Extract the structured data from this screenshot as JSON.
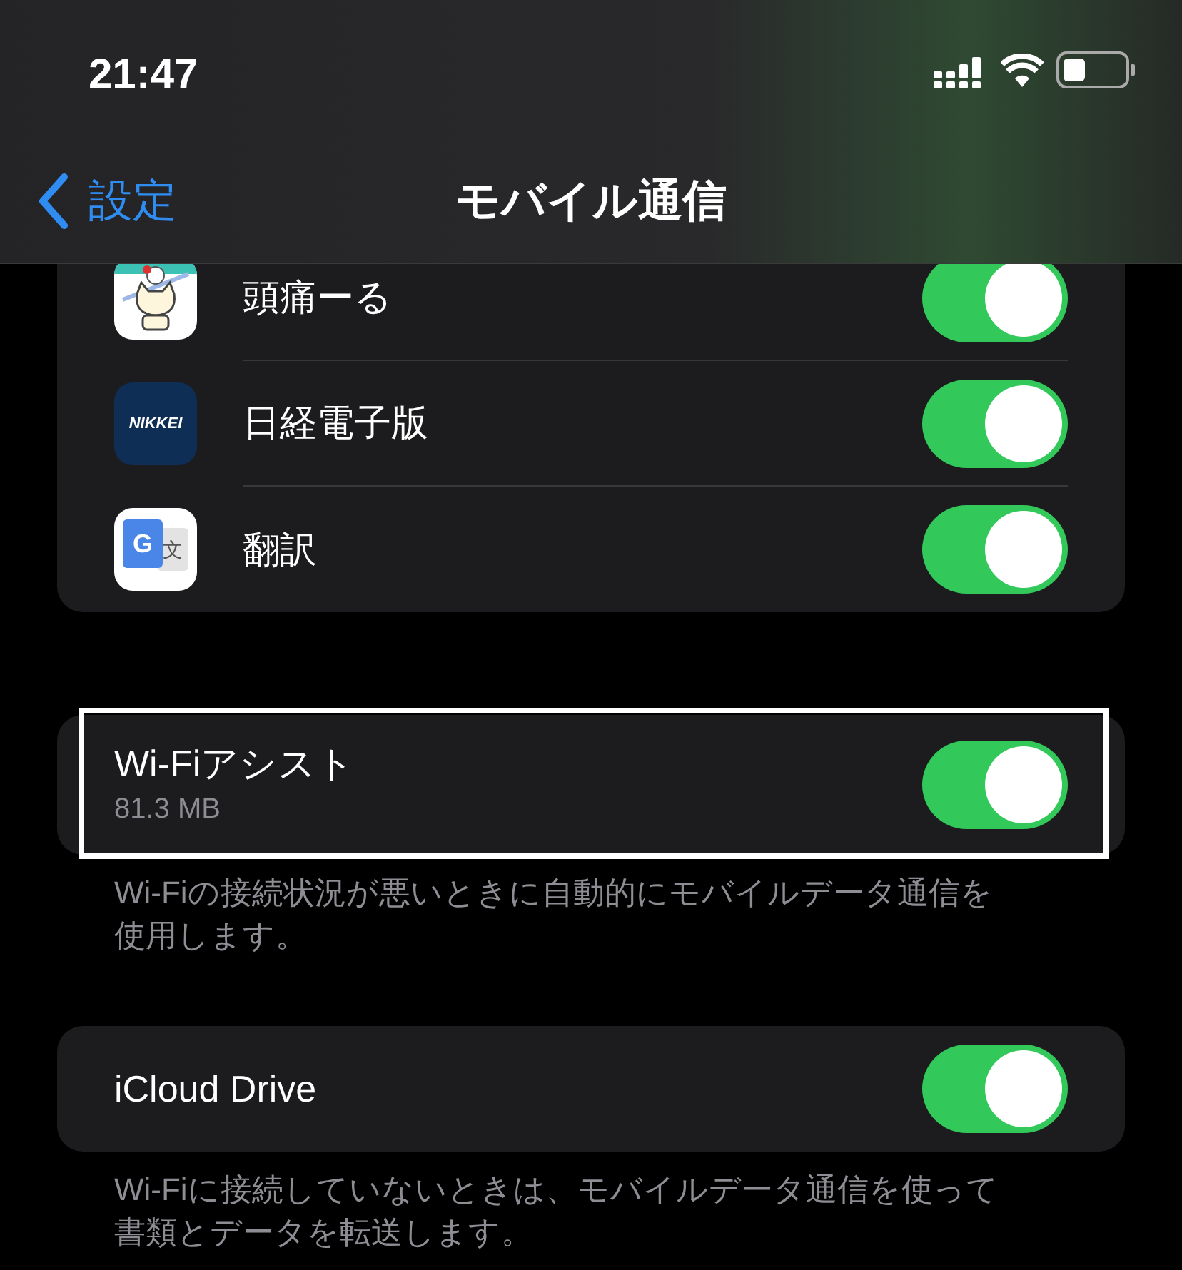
{
  "status_bar": {
    "time": "21:47"
  },
  "nav": {
    "back": "設定",
    "title": "モバイル通信"
  },
  "apps": [
    {
      "name": "頭痛ーる",
      "kind": "cat",
      "on": true
    },
    {
      "name": "日経電子版",
      "kind": "nikkei",
      "icon_text": "NIKKEI",
      "on": true
    },
    {
      "name": "翻訳",
      "kind": "translate",
      "icon_glyphs": [
        "G",
        "文"
      ],
      "on": true
    }
  ],
  "groups": [
    {
      "title": "Wi-Fiアシスト",
      "detail": "81.3 MB",
      "on": true,
      "highlighted": true,
      "footer": "Wi-Fiの接続状況が悪いときに自動的にモバイルデータ通信を使用します。"
    },
    {
      "title": "iCloud Drive",
      "on": true,
      "highlighted": false,
      "footer": "Wi-Fiに接続していないときは、モバイルデータ通信を使って書類とデータを転送します。"
    }
  ]
}
